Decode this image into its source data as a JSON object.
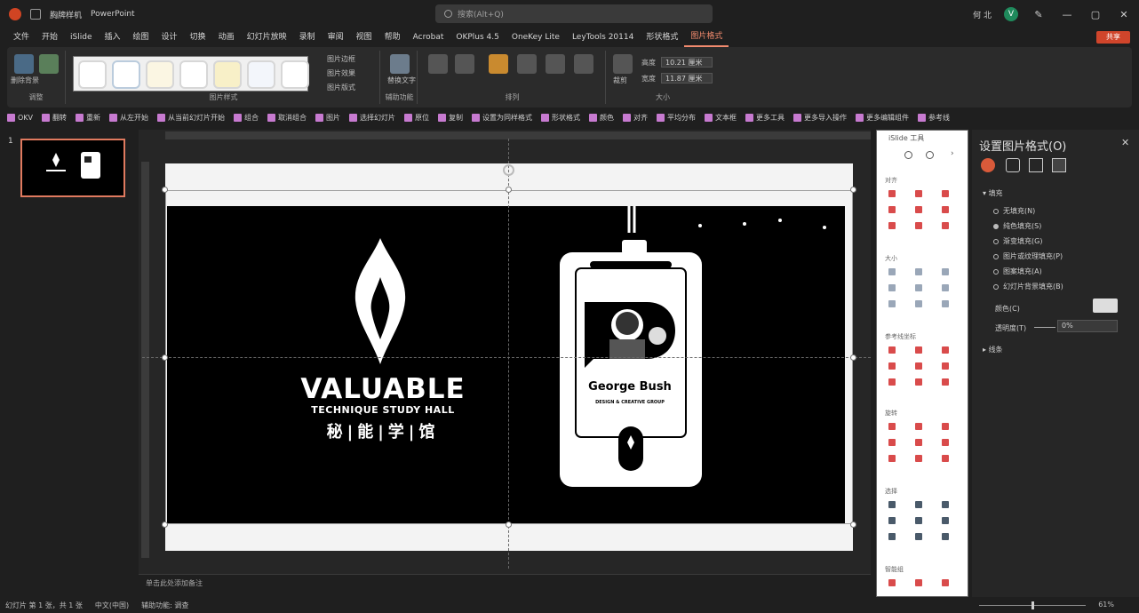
{
  "titlebar": {
    "app_name": "PowerPoint",
    "doc_title": "胸牌样机",
    "search_placeholder": "搜索(Alt+Q)",
    "user_name": "何 北",
    "avatar_letter": "V",
    "win_controls": [
      "—",
      "▢",
      "✕"
    ]
  },
  "menu": {
    "items": [
      "文件",
      "开始",
      "iSlide",
      "插入",
      "绘图",
      "设计",
      "切换",
      "动画",
      "幻灯片放映",
      "录制",
      "审阅",
      "视图",
      "帮助",
      "Acrobat",
      "OKPlus 4.5",
      "OneKey Lite",
      "LeyTools 20114",
      "形状格式",
      "图片格式"
    ],
    "active_index": 18,
    "share_label": "共享"
  },
  "ribbon": {
    "groups": [
      "调整",
      "图片样式",
      "辅助功能",
      "排列",
      "大小"
    ],
    "btn_labels": {
      "remove_bg": "删除背景",
      "artistic": "艺术效果",
      "border": "图片边框",
      "effects": "图片效果",
      "layout": "图片版式",
      "alt_text": "替换文字",
      "height_label": "高度",
      "height_value": "10.21 厘米",
      "width_label": "宽度",
      "width_value": "11.87 厘米",
      "crop": "裁剪"
    }
  },
  "quickbar": {
    "items": [
      "OKV",
      "翻转",
      "重新",
      "从左开始",
      "从当前幻灯片开始",
      "组合",
      "取消组合",
      "图片",
      "选择幻灯片",
      "原位",
      "复制",
      "设置为同样格式",
      "形状格式",
      "颜色",
      "对齐",
      "平均分布",
      "文本框",
      "更多工具",
      "更多导入操作",
      "更多编辑组件",
      "参考线"
    ]
  },
  "slide_pane": {
    "slide_number": "1"
  },
  "slide": {
    "logo_main": "VALUABLE",
    "logo_sub": "TECHNIQUE STUDY HALL",
    "logo_cn": "秘|能|学|馆",
    "badge_name": "George Bush",
    "badge_sub": "DESIGN & CREATIVE GROUP"
  },
  "notes": {
    "placeholder": "单击此处添加备注"
  },
  "status": {
    "items": [
      "幻灯片 第 1 张，共 1 张",
      "中文(中国)",
      "辅助功能: 调查"
    ],
    "zoom": "61%"
  },
  "plugin_panel": {
    "title": "iSlide 工具",
    "sections": [
      "对齐",
      "大小",
      "参考线坐标",
      "旋转",
      "选择",
      "智能组"
    ]
  },
  "format_pane": {
    "title": "设置图片格式(O)",
    "section_fill": "填充",
    "options": [
      "无填充(N)",
      "纯色填充(S)",
      "渐变填充(G)",
      "图片或纹理填充(P)",
      "图案填充(A)",
      "幻灯片背景填充(B)"
    ],
    "selected_option_index": 1,
    "color_label": "颜色(C)",
    "transparency_label": "透明度(T)",
    "transparency_value": "0%",
    "section_line": "线条"
  },
  "colors": {
    "accent": "#f28b6e",
    "share": "#d0452b",
    "ribbon_bg": "#2b2b2b",
    "app_bg": "#1f1f1f"
  }
}
